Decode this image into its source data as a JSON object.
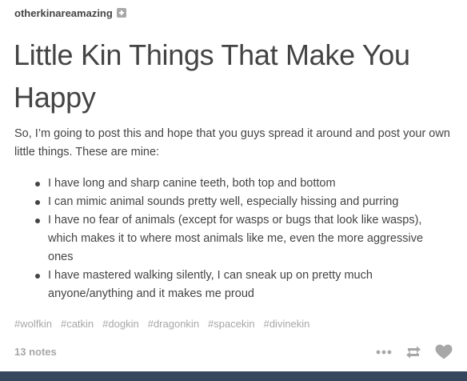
{
  "post": {
    "username": "otherkinareamazing",
    "follow_icon": "plus-square-icon",
    "title": "Little Kin Things That Make You Happy",
    "intro": "So, I’m going to post this and hope that you guys spread it around and post your own little things. These are mine:",
    "bullets": [
      "I have long and sharp canine teeth, both top and bottom",
      "I can mimic animal sounds pretty well, especially hissing and purring",
      "I have no fear of animals (except for wasps or bugs that look like wasps), which makes it to where most animals like me, even the more aggressive ones",
      "I have mastered walking silently, I can sneak up on pretty much anyone/anything and it makes me proud"
    ],
    "tags": [
      "#wolfkin",
      "#catkin",
      "#dogkin",
      "#dragonkin",
      "#spacekin",
      "#divinekin"
    ],
    "notes": "13 notes",
    "controls": [
      "more-icon",
      "reblog-icon",
      "heart-icon"
    ]
  },
  "colors": {
    "text": "#444444",
    "muted": "#a7a7a7",
    "bottom_bar": "#36465d"
  }
}
